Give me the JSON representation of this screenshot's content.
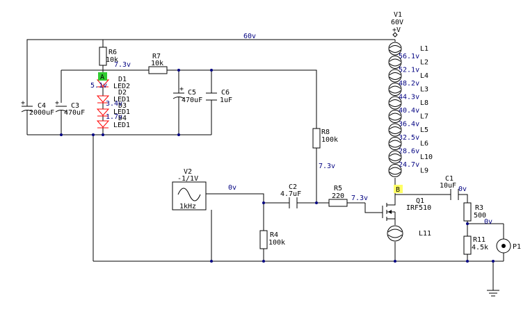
{
  "colors": {
    "wire": "#000000",
    "voltage_text": "#000080",
    "led_red": "#ff0000",
    "probe_green": "#33cc33",
    "probe_yellow": "#ffff66"
  },
  "probes": {
    "a": "A",
    "b": "B"
  },
  "components": {
    "v1": {
      "name": "V1",
      "value": "60V",
      "pin": "+V"
    },
    "v2": {
      "name": "V2",
      "value": "-1/1V",
      "freq": "1kHz"
    },
    "c1": {
      "name": "C1",
      "value": "10uF"
    },
    "c2": {
      "name": "C2",
      "value": "4.7uF"
    },
    "c3": {
      "name": "C3",
      "value": "470uF"
    },
    "c4": {
      "name": "C4",
      "value": "2000uF"
    },
    "c5": {
      "name": "C5",
      "value": "470uF"
    },
    "c6": {
      "name": "C6",
      "value": "1uF"
    },
    "r3": {
      "name": "R3",
      "value": "500"
    },
    "r4": {
      "name": "R4",
      "value": "100k"
    },
    "r5": {
      "name": "R5",
      "value": "220"
    },
    "r6": {
      "name": "R6",
      "value": "10k"
    },
    "r7": {
      "name": "R7",
      "value": "10k"
    },
    "r8": {
      "name": "R8",
      "value": "100k"
    },
    "r11": {
      "name": "R11",
      "value": "4.5k"
    },
    "q1": {
      "name": "Q1",
      "value": "IRF510"
    },
    "d1": {
      "name": "D1",
      "value": "LED2"
    },
    "d2": {
      "name": "D2",
      "value": "LED1"
    },
    "d3": {
      "name": "D3",
      "value": "LED1"
    },
    "d4": {
      "name": "D4",
      "value": "LED1"
    },
    "p1": {
      "name": "P1"
    },
    "lamps": [
      "L1",
      "L2",
      "L4",
      "L3",
      "L8",
      "L7",
      "L5",
      "L6",
      "L10",
      "L9"
    ],
    "l11": "L11"
  },
  "voltages": {
    "top_rail": "60v",
    "node_a": "7.3v",
    "d1_node": "5.1v",
    "d2_node": "3.4v",
    "d3_node": "1.7v",
    "r8_node": "7.3v",
    "r5_node": "7.3v",
    "v2_out": "0v",
    "c1_out": "0v",
    "r11_top": "0v",
    "lamp_nodes": [
      "56.1v",
      "52.1v",
      "48.2v",
      "44.3v",
      "40.4v",
      "36.4v",
      "32.5v",
      "28.6v",
      "24.7v"
    ]
  }
}
